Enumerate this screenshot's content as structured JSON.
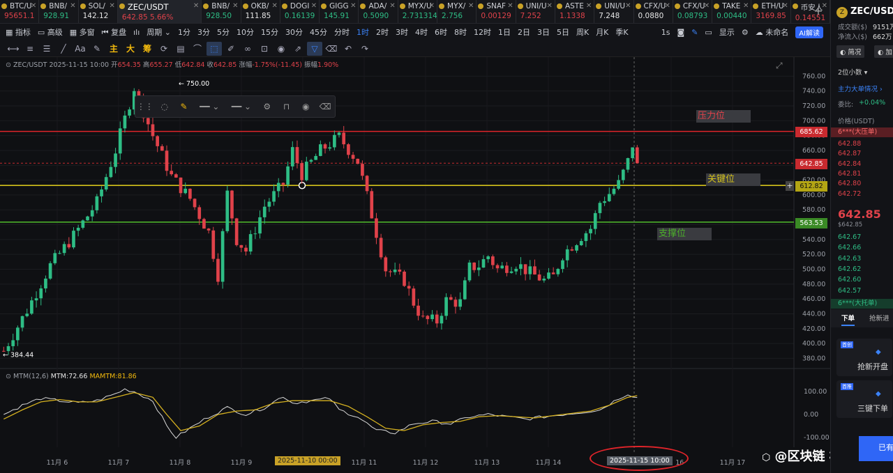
{
  "tabs": [
    {
      "sym": "BTC/U",
      "price": "95651.1",
      "dir": "down"
    },
    {
      "sym": "BNB/",
      "price": "928.91",
      "dir": "up"
    },
    {
      "sym": "SOL/",
      "price": "142.12",
      "dir": "wht"
    },
    {
      "sym": "ZEC/USDT",
      "price": "642.85  5.66%",
      "dir": "down",
      "active": true
    },
    {
      "sym": "BNB/",
      "price": "928.50",
      "dir": "up"
    },
    {
      "sym": "OKB/",
      "price": "111.85",
      "dir": "wht"
    },
    {
      "sym": "DOGI",
      "price": "0.16139",
      "dir": "up"
    },
    {
      "sym": "GIGG",
      "price": "145.91",
      "dir": "up"
    },
    {
      "sym": "ADA/",
      "price": "0.5090",
      "dir": "up"
    },
    {
      "sym": "MYX/U",
      "price": "2.731314",
      "dir": "up"
    },
    {
      "sym": "MYX/",
      "price": "2.756",
      "dir": "up"
    },
    {
      "sym": "SNAF",
      "price": "0.00129",
      "dir": "down"
    },
    {
      "sym": "UNI/U",
      "price": "7.252",
      "dir": "down"
    },
    {
      "sym": "ASTE",
      "price": "1.1338",
      "dir": "down"
    },
    {
      "sym": "UNI/U",
      "price": "7.248",
      "dir": "wht"
    },
    {
      "sym": "CFX/U",
      "price": "0.0880",
      "dir": "wht"
    },
    {
      "sym": "CFX/U",
      "price": "0.08793",
      "dir": "up"
    },
    {
      "sym": "TAKE",
      "price": "0.00440",
      "dir": "up"
    },
    {
      "sym": "ETH/U",
      "price": "3169.85",
      "dir": "down"
    },
    {
      "sym": "币安人",
      "price": "0.14551",
      "dir": "down"
    }
  ],
  "toolbar": {
    "indicators": "指标",
    "advanced": "高级",
    "multi": "多窗",
    "replay": "复盘",
    "period": "周期",
    "intervals": [
      "1分",
      "3分",
      "5分",
      "10分",
      "15分",
      "30分",
      "45分",
      "分时",
      "1时",
      "2时",
      "3时",
      "4时",
      "6时",
      "8时",
      "12时",
      "1日",
      "2日",
      "3日",
      "5日",
      "周K",
      "月K",
      "季K"
    ],
    "active_interval": "1时",
    "right_1s": "1s",
    "display": "显示",
    "unnamed": "未命名",
    "ai": "AI解读"
  },
  "draw_tools": {
    "main": "主",
    "big": "大",
    "chip": "筹"
  },
  "chart_info": {
    "symbol": "ZEC/USDT",
    "time": "2025-11-15 10:00",
    "open_l": "开",
    "open": "654.35",
    "high_l": "高",
    "high": "655.27",
    "low_l": "低",
    "low": "642.84",
    "close_l": "收",
    "close": "642.85",
    "chg_l": "涨幅",
    "chg": "-1.75%(-11.45)",
    "amp_l": "振幅",
    "amp": "1.90%"
  },
  "mtm": {
    "name": "MTM(12,6)",
    "mtm_label": "MTM:",
    "mtm": "72.66",
    "ma_label": "MAMTM:",
    "ma": "81.86"
  },
  "levels": {
    "resistance": "压力位",
    "key": "关键位",
    "support": "支撑位"
  },
  "tags": {
    "resist": "685.62",
    "last": "642.85",
    "key": "612.82",
    "support": "563.53"
  },
  "annotations": {
    "high": "750.00",
    "low": "384.44"
  },
  "time_labels": {
    "hover": "2025-11-10 00:00",
    "cross": "2025-11-15 10:00"
  },
  "watermark": "@区块链 枫叶",
  "colors": {
    "up": "#2ebd85",
    "down": "#e0424a",
    "resist": "#e0242a",
    "key": "#d4c21b",
    "support": "#4caf2a",
    "mtm": "#d9d9d9",
    "mamtm": "#d4b020"
  },
  "chart_data": {
    "type": "candlestick",
    "x_ticks": [
      "11月 6",
      "11月 7",
      "11月 8",
      "11月 9",
      "2025-11-10 00:00",
      "11月 11",
      "11月 12",
      "11月 13",
      "11月 14",
      "2025-11-15 10:00",
      "11月 16",
      "11月 17"
    ],
    "y_ticks": [
      760,
      740,
      720,
      700,
      680,
      660,
      640,
      620,
      600,
      580,
      560,
      540,
      520,
      500,
      480,
      460,
      440,
      420,
      400,
      380
    ],
    "y_range": [
      370,
      770
    ],
    "mtm_ticks": [
      100,
      0,
      -100
    ],
    "mtm_range": [
      -120,
      150
    ],
    "close_path": [
      [
        0,
        390
      ],
      [
        5,
        445
      ],
      [
        10,
        505
      ],
      [
        15,
        545
      ],
      [
        20,
        590
      ],
      [
        24,
        660
      ],
      [
        28,
        745
      ],
      [
        32,
        680
      ],
      [
        36,
        625
      ],
      [
        40,
        595
      ],
      [
        44,
        550
      ],
      [
        46,
        492
      ],
      [
        48,
        602
      ],
      [
        50,
        540
      ],
      [
        52,
        525
      ],
      [
        56,
        585
      ],
      [
        60,
        615
      ],
      [
        62,
        660
      ],
      [
        64,
        628
      ],
      [
        68,
        660
      ],
      [
        72,
        678
      ],
      [
        76,
        645
      ],
      [
        78,
        598
      ],
      [
        82,
        500
      ],
      [
        86,
        485
      ],
      [
        88,
        455
      ],
      [
        90,
        432
      ],
      [
        93,
        430
      ],
      [
        95,
        458
      ],
      [
        98,
        455
      ],
      [
        100,
        502
      ],
      [
        102,
        505
      ],
      [
        104,
        518
      ],
      [
        106,
        500
      ],
      [
        110,
        508
      ],
      [
        113,
        495
      ],
      [
        116,
        485
      ],
      [
        118,
        490
      ],
      [
        120,
        520
      ],
      [
        124,
        545
      ],
      [
        126,
        555
      ],
      [
        128,
        590
      ],
      [
        130,
        602
      ],
      [
        132,
        615
      ],
      [
        134,
        645
      ],
      [
        135,
        668
      ],
      [
        136,
        642
      ]
    ],
    "mtm_path": [
      [
        0,
        0
      ],
      [
        4,
        40
      ],
      [
        8,
        70
      ],
      [
        12,
        60
      ],
      [
        16,
        50
      ],
      [
        20,
        60
      ],
      [
        24,
        90
      ],
      [
        26,
        110
      ],
      [
        28,
        100
      ],
      [
        32,
        60
      ],
      [
        35,
        -50
      ],
      [
        37,
        -100
      ],
      [
        40,
        -60
      ],
      [
        44,
        -10
      ],
      [
        48,
        30
      ],
      [
        52,
        0
      ],
      [
        56,
        30
      ],
      [
        60,
        80
      ],
      [
        62,
        50
      ],
      [
        66,
        60
      ],
      [
        70,
        70
      ],
      [
        72,
        20
      ],
      [
        76,
        -10
      ],
      [
        80,
        -70
      ],
      [
        84,
        -80
      ],
      [
        88,
        -40
      ],
      [
        92,
        -30
      ],
      [
        96,
        -40
      ],
      [
        100,
        -10
      ],
      [
        104,
        0
      ],
      [
        108,
        -10
      ],
      [
        112,
        -20
      ],
      [
        116,
        -10
      ],
      [
        120,
        0
      ],
      [
        124,
        10
      ],
      [
        128,
        20
      ],
      [
        132,
        70
      ],
      [
        134,
        90
      ],
      [
        136,
        72.66
      ]
    ],
    "mamtm_path": [
      [
        0,
        -20
      ],
      [
        4,
        20
      ],
      [
        8,
        55
      ],
      [
        12,
        65
      ],
      [
        16,
        55
      ],
      [
        20,
        55
      ],
      [
        24,
        75
      ],
      [
        28,
        95
      ],
      [
        32,
        75
      ],
      [
        35,
        0
      ],
      [
        38,
        -70
      ],
      [
        42,
        -50
      ],
      [
        46,
        0
      ],
      [
        50,
        15
      ],
      [
        54,
        20
      ],
      [
        58,
        50
      ],
      [
        62,
        60
      ],
      [
        66,
        60
      ],
      [
        70,
        60
      ],
      [
        74,
        35
      ],
      [
        78,
        -10
      ],
      [
        82,
        -60
      ],
      [
        86,
        -70
      ],
      [
        90,
        -45
      ],
      [
        94,
        -35
      ],
      [
        98,
        -30
      ],
      [
        102,
        -10
      ],
      [
        106,
        -5
      ],
      [
        110,
        -10
      ],
      [
        114,
        -15
      ],
      [
        118,
        -5
      ],
      [
        122,
        5
      ],
      [
        126,
        15
      ],
      [
        130,
        40
      ],
      [
        134,
        75
      ],
      [
        136,
        81.86
      ]
    ]
  },
  "right": {
    "symbol": "ZEC/USD",
    "vol_l": "成交额($)",
    "vol": "9151万",
    "inflow_l": "净流入($)",
    "inflow": "662万",
    "b1": "简况",
    "b2": "加",
    "decimals": "2位小数",
    "mainflow": "主力大单情况",
    "ratio_l": "委比:",
    "ratio": "+0.04%",
    "price_h": "价格(USDT)",
    "big_ask": "6***(大压单)",
    "asks": [
      "642.88",
      "642.87",
      "642.84",
      "642.81",
      "642.80",
      "642.72"
    ],
    "last": "642.85",
    "last_sub": "$642.85",
    "bids": [
      "642.67",
      "642.66",
      "642.63",
      "642.62",
      "642.60",
      "642.57"
    ],
    "big_bid": "6***(大托单)",
    "tab1": "下单",
    "tab2": "抢新进",
    "card1_tag": "首创",
    "card1": "抢新开盘",
    "card2_tag": "首推",
    "card2": "三键下单",
    "side_btn": "已有"
  }
}
